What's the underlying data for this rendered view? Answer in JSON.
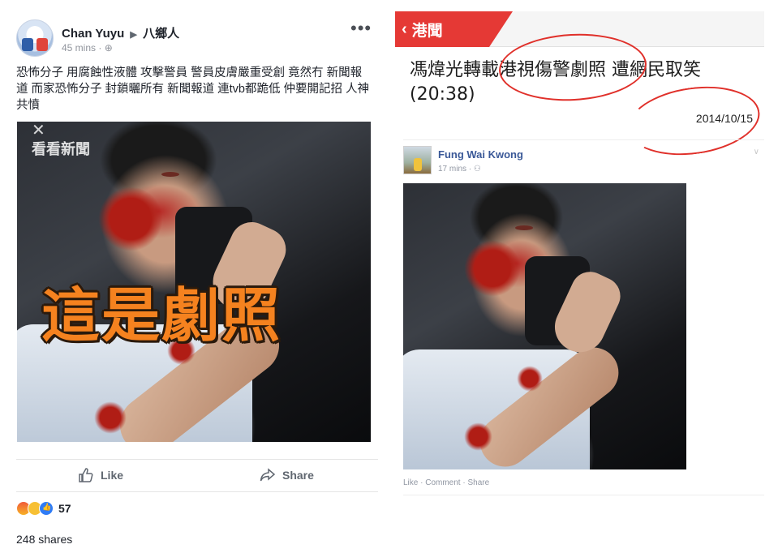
{
  "left_post": {
    "author": "Chan Yuyu",
    "group": "八鄉人",
    "time": "45 mins",
    "time_separator": " · ",
    "more_label": "•••",
    "text": "恐怖分子 用腐蝕性液體 攻擊警員 警員皮膚嚴重受創 竟然冇 新聞報道 而家恐怖分子 封鎖曬所有 新聞報道 連tvb都跪低 仲要開記招 人神共憤",
    "photo_watermark": "看看新聞",
    "photo_close": "✕",
    "overlay_text": "這是劇照",
    "like_label": "Like",
    "share_label": "Share",
    "reaction_count": "57",
    "shares": "248 shares"
  },
  "right_post": {
    "tab_label": "港聞",
    "back_icon": "‹",
    "headline": "馮煒光轉載港視傷警劇照 遭網民取笑(20:38)",
    "date": "2014/10/15",
    "fb_author": "Fung Wai Kwong",
    "fb_time": "17 mins · ⚇",
    "chevron": "∨",
    "actions": "Like · Comment · Share"
  },
  "colors": {
    "news_red": "#e53935",
    "annotation_red": "#e0302a",
    "overlay_orange": "#f5821f",
    "fb_link_blue": "#3b5998"
  }
}
